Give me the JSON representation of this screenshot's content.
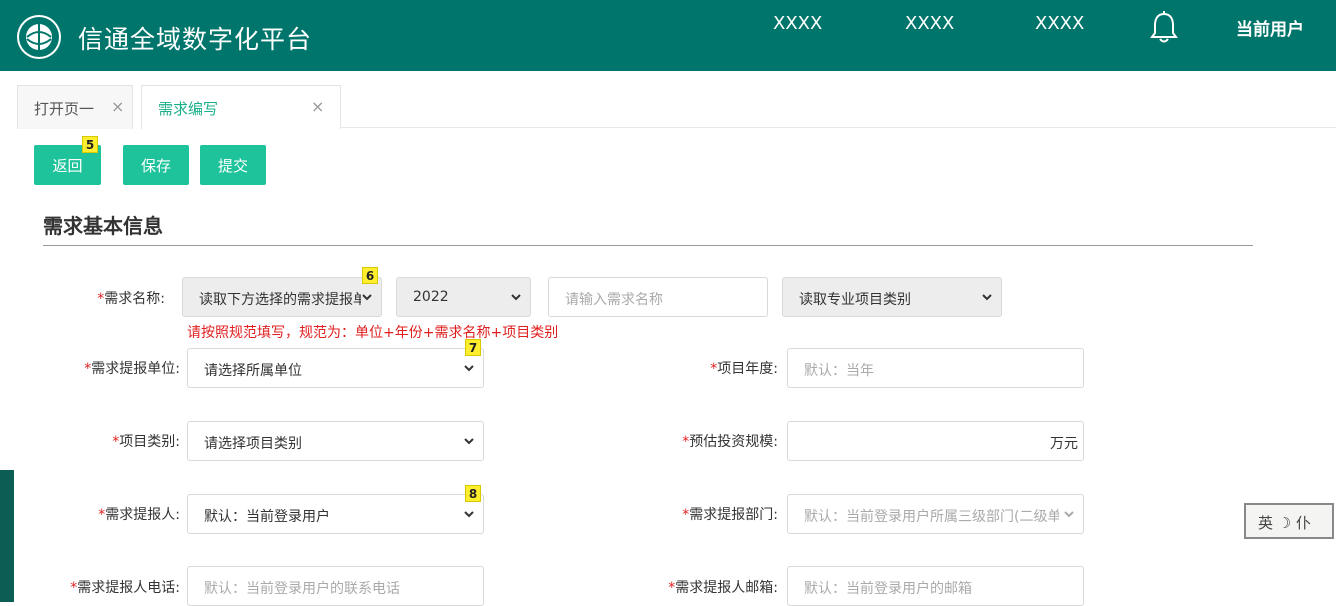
{
  "header": {
    "app_title": "信通全域数字化平台",
    "nav": [
      "XXXX",
      "XXXX",
      "XXXX"
    ],
    "current_user": "当前用户"
  },
  "tabs": [
    {
      "label": "打开页一",
      "close": "×"
    },
    {
      "label": "需求编写",
      "close": "×"
    }
  ],
  "toolbar": {
    "back_label": "返回",
    "save_label": "保存",
    "submit_label": "提交"
  },
  "badges": [
    "5",
    "6",
    "7",
    "8"
  ],
  "section": {
    "title": "需求基本信息"
  },
  "form": {
    "demand_name": {
      "label": "需求名称:",
      "select_unit": "读取下方选择的需求提报单位",
      "year": "2022",
      "name_placeholder": "请输入需求名称",
      "category": "读取专业项目类别",
      "hint": "请按照规范填写，规范为：单位+年份+需求名称+项目类别"
    },
    "report_unit": {
      "label": "需求提报单位:",
      "value": "请选择所属单位"
    },
    "project_year": {
      "label": "项目年度:",
      "placeholder": "默认：当年"
    },
    "project_category": {
      "label": "项目类别:",
      "value": "请选择项目类别"
    },
    "invest_scale": {
      "label": "预估投资规模:",
      "unit": "万元"
    },
    "reporter": {
      "label": "需求提报人:",
      "value": "默认：当前登录用户"
    },
    "reporter_dept": {
      "label": "需求提报部门:",
      "value": "默认：当前登录用户所属三级部门(二级单位)"
    },
    "reporter_phone": {
      "label": "需求提报人电话:",
      "placeholder": "默认：当前登录用户的联系电话"
    },
    "reporter_email": {
      "label": "需求提报人邮箱:",
      "placeholder": "默认：当前登录用户的邮箱"
    }
  },
  "ime": {
    "text": "英 ☽ 仆"
  },
  "colors": {
    "header": "#00756b",
    "accent": "#1ec39b",
    "required": "#e02020",
    "badge": "#ffee2e"
  }
}
